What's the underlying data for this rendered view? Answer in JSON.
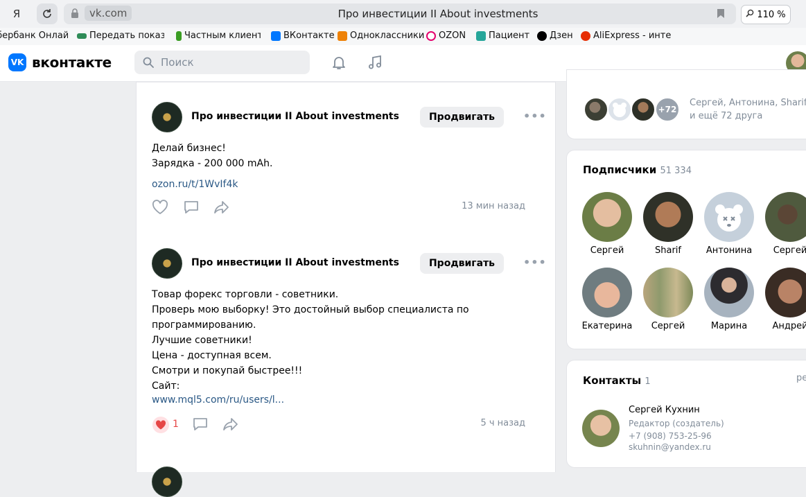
{
  "browser": {
    "url": "vk.com",
    "title": "Про инвестиции II About investments",
    "zoom": "110 %"
  },
  "bookmarks": [
    {
      "label": "Сбербанк Онлайн",
      "color": "#21a038"
    },
    {
      "label": "Передать показания",
      "color": "#2e8b57"
    },
    {
      "label": "Частным клиентам",
      "color": "#3a9d23"
    },
    {
      "label": "ВКонтакте",
      "color": "#0077ff"
    },
    {
      "label": "Одноклассники",
      "color": "#ee8208"
    },
    {
      "label": "OZON",
      "color": "#005bff"
    },
    {
      "label": "Пациент",
      "color": "#26a69a"
    },
    {
      "label": "Дзен",
      "color": "#000000"
    },
    {
      "label": "AliExpress - интернет",
      "color": "#e62e04"
    }
  ],
  "header": {
    "logo_text": "вконтакте",
    "search_placeholder": "Поиск"
  },
  "posts": [
    {
      "author": "Про инвестиции II About investments",
      "promote_label": "Продвигать",
      "text_lines": [
        "Делай бизнес!",
        "Зарядка - 200 000 mAh."
      ],
      "link": "ozon.ru/t/1WvIf4k",
      "time": "13 мин назад",
      "likes": ""
    },
    {
      "author": "Про инвестиции II About investments",
      "promote_label": "Продвигать",
      "text_lines": [
        "Товар форекс торговли - советники.",
        "Проверь мою выборку! Это достойный выбор специалиста по",
        "программированию.",
        "Лучшие советники!",
        "Цена - доступная всем.",
        "Смотри и покупай быстрее!!!",
        "Сайт:"
      ],
      "link": "www.mql5.com/ru/users/l...",
      "time": "5 ч назад",
      "likes": "1"
    }
  ],
  "friends": {
    "more_badge": "+72",
    "line1": "Сергей, Антонина, Sharif",
    "line2": "и ещё 72 друга"
  },
  "subscribers": {
    "title": "Подписчики",
    "count": "51 334",
    "items": [
      {
        "name": "Сергей"
      },
      {
        "name": "Sharif"
      },
      {
        "name": "Антонина"
      },
      {
        "name": "Сергей"
      },
      {
        "name": "Екатерина"
      },
      {
        "name": "Сергей"
      },
      {
        "name": "Марина"
      },
      {
        "name": "Андрей"
      }
    ]
  },
  "contacts": {
    "title": "Контакты",
    "count": "1",
    "edit_label": "ред.",
    "name": "Сергей Кухнин",
    "role": "Редактор (создатель)",
    "phone": "+7 (908) 753-25-96",
    "email": "skuhnin@yandex.ru"
  }
}
